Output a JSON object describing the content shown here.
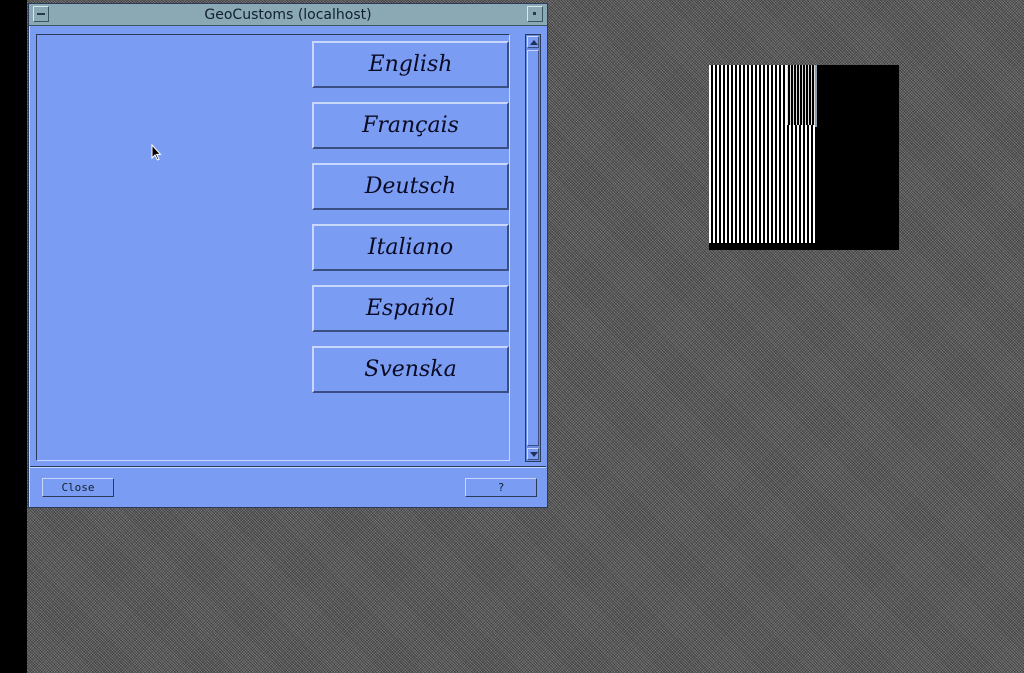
{
  "window": {
    "title": "GeoCustoms (localhost)"
  },
  "languages": [
    {
      "label": "English"
    },
    {
      "label": "Français"
    },
    {
      "label": "Deutsch"
    },
    {
      "label": "Italiano"
    },
    {
      "label": "Español"
    },
    {
      "label": "Svenska"
    }
  ],
  "footer": {
    "close_label": "Close",
    "help_label": "?"
  },
  "colors": {
    "window_bg": "#7a9cf2",
    "titlebar_bg": "#8aa9b4",
    "desktop_bg": "#5e5e5e"
  }
}
